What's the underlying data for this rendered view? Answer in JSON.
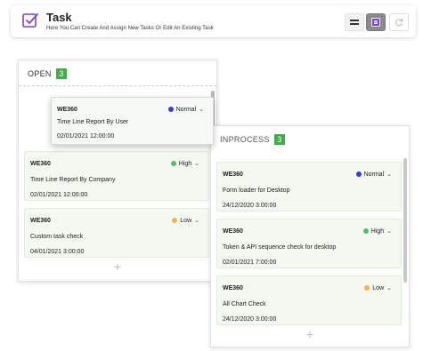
{
  "header": {
    "title": "Task",
    "subtitle": "Here You Can Create And Assign New Tasks Or Edit An Existing Task",
    "icons": {
      "task": "edit-square-icon",
      "list": "list-view-icon",
      "board": "board-view-icon",
      "refresh": "refresh-icon"
    }
  },
  "colors": {
    "accent": "#7b3fe4",
    "badge": "#3fae49",
    "normal": "#3a3ae0",
    "high": "#4cbf6a",
    "low": "#f3b54a",
    "card_bg": "#f3f8f1"
  },
  "columns": {
    "open": {
      "title": "OPEN",
      "count": "3",
      "add_label": "+",
      "dragging_card": {
        "code": "WE360",
        "name": "Time Line Report By User",
        "date": "02/01/2021 12:00:00",
        "priority": "Normal"
      },
      "cards": [
        {
          "code": "WE360",
          "name": "Time Line Report By Company",
          "date": "02/01/2021 12:00:00",
          "priority": "High"
        },
        {
          "code": "WE360",
          "name": "Custom task check",
          "date": "04/01/2021 3:00:00",
          "priority": "Low"
        }
      ]
    },
    "inprocess": {
      "title": "INPROCESS",
      "count": "3",
      "add_label": "+",
      "cards": [
        {
          "code": "WE360",
          "name": "Form loader for Desktop",
          "date": "24/12/2020 3:00:00",
          "priority": "Normal"
        },
        {
          "code": "WE360",
          "name": "Token & API sequence check for desktop",
          "date": "02/01/2021 7:00:00",
          "priority": "High"
        },
        {
          "code": "WE360",
          "name": "All Chart Check",
          "date": "24/12/2020 3:00:00",
          "priority": "Low"
        }
      ]
    }
  }
}
